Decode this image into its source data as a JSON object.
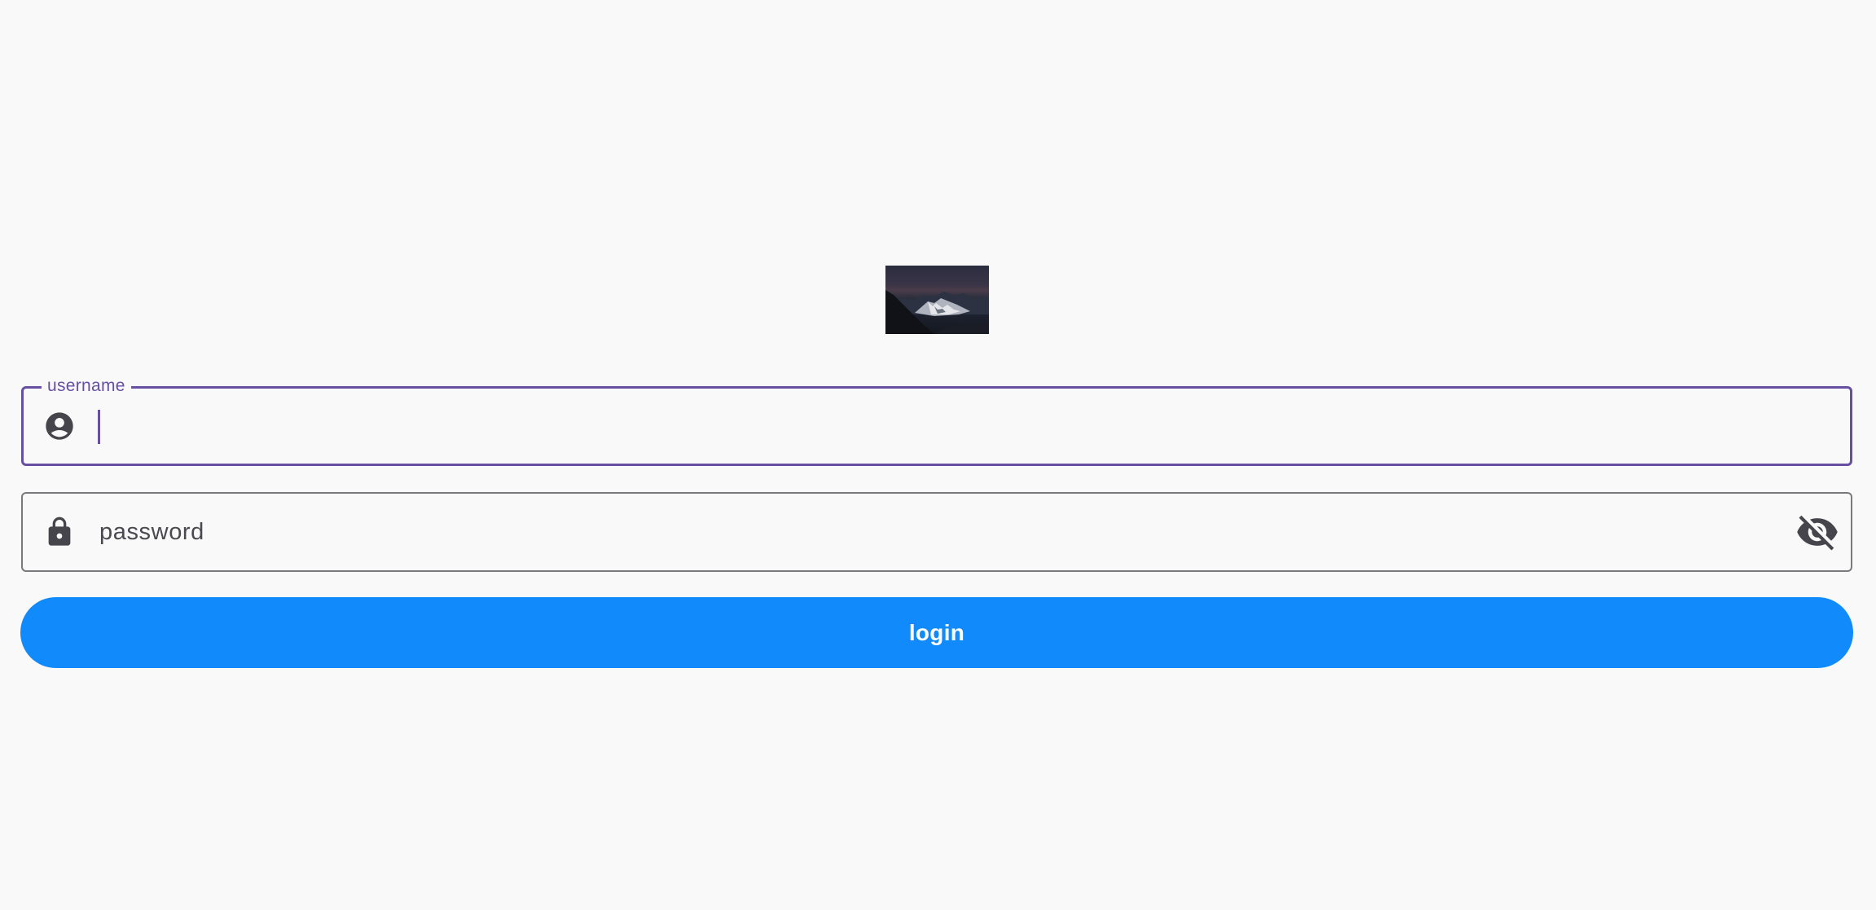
{
  "logo": {
    "icon": "mountain-night-photo"
  },
  "username": {
    "label": "username",
    "value": "",
    "icon": "account-circle-icon"
  },
  "password": {
    "placeholder": "password",
    "value": "",
    "icon": "lock-icon",
    "toggle_icon": "visibility-off-icon"
  },
  "login": {
    "label": "login"
  },
  "colors": {
    "background": "#f9f9f9",
    "focus_accent": "#6750a4",
    "outline": "#7a7a7e",
    "button": "#118afc",
    "icon": "#46454b"
  }
}
